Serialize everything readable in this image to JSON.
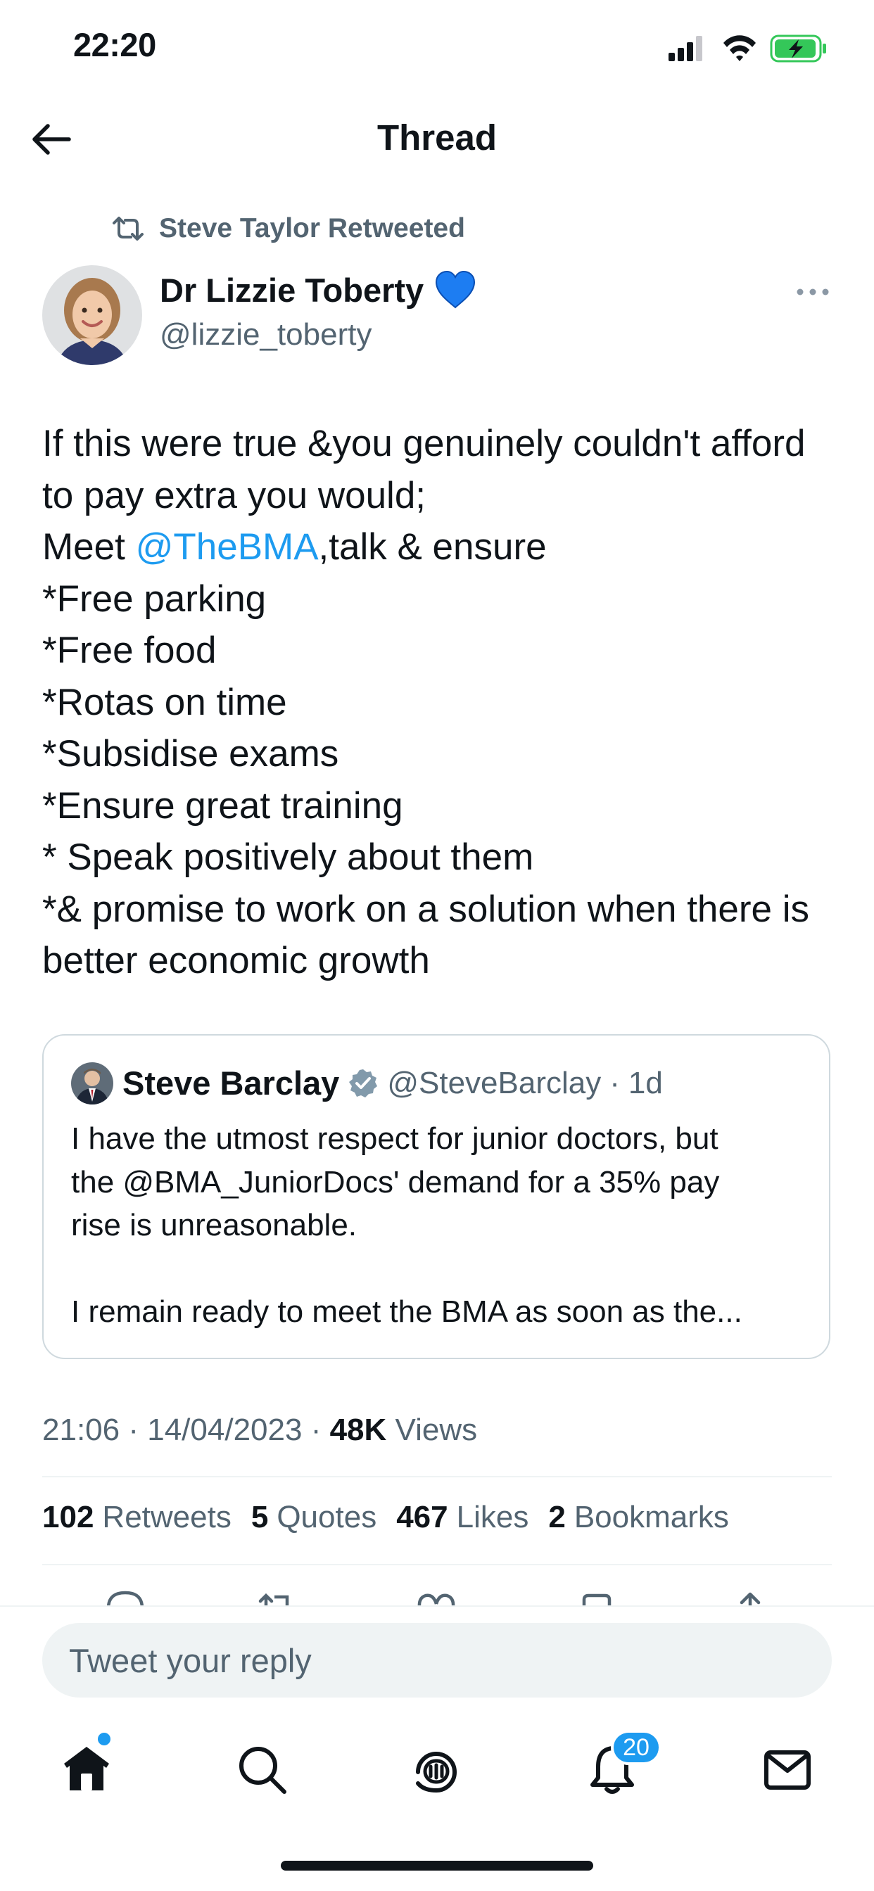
{
  "status_bar": {
    "time": "22:20"
  },
  "nav": {
    "title": "Thread"
  },
  "retweet_context": {
    "text": "Steve Taylor Retweeted"
  },
  "tweet": {
    "author_name": "Dr Lizzie Toberty",
    "author_badge": "💙",
    "author_handle": "@lizzie_toberty",
    "body_lines": [
      "If this were true &you genuinely couldn't afford",
      "to pay extra you would;",
      "Meet ",
      "@TheBMA",
      ",talk & ensure",
      "*Free parking",
      "*Free food",
      "*Rotas on time",
      "*Subsidise exams",
      "*Ensure great training",
      "* Speak positively about them",
      "*& promise to work on a solution when there is",
      "better economic growth"
    ],
    "meta": {
      "time": "21:06",
      "separator": "·",
      "date": "14/04/2023",
      "views_count": "48K",
      "views_label": "Views"
    },
    "stats": {
      "retweets_count": "102",
      "retweets_label": "Retweets",
      "quotes_count": "5",
      "quotes_label": "Quotes",
      "likes_count": "467",
      "likes_label": "Likes",
      "bookmarks_count": "2",
      "bookmarks_label": "Bookmarks"
    }
  },
  "quoted_tweet": {
    "author_name": "Steve Barclay",
    "author_handle": "@SteveBarclay",
    "separator": "·",
    "age": "1d",
    "text_lines": [
      "I have the utmost respect for junior doctors, but",
      "the @BMA_JuniorDocs' demand for a 35% pay",
      "rise is unreasonable.",
      "",
      "I remain ready to meet the BMA as soon as the..."
    ]
  },
  "reply": {
    "placeholder": "Tweet your reply"
  },
  "tab_bar": {
    "items": [
      "home-icon",
      "search-icon",
      "spaces-icon",
      "notifications-icon",
      "messages-icon"
    ],
    "notifications_badge": "20"
  },
  "colors": {
    "accent": "#1d9bf0",
    "text": "#0f1419",
    "secondary_text": "#536471",
    "divider": "#eff3f4",
    "battery_fill": "#34c759"
  }
}
